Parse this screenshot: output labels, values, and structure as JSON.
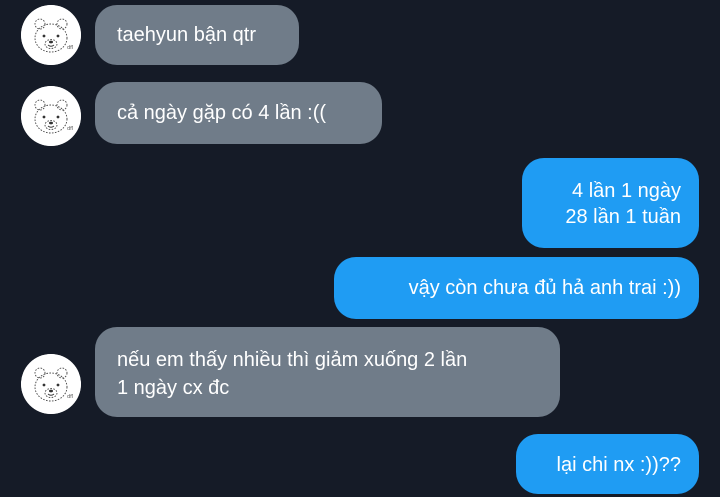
{
  "conversation": {
    "messages": [
      {
        "sender": "other",
        "lines": [
          "taehyun bận qtr"
        ]
      },
      {
        "sender": "other",
        "lines": [
          "cả ngày gặp có 4 lần :(("
        ]
      },
      {
        "sender": "me",
        "lines": [
          "4 lần 1 ngày",
          "28 lần 1 tuần"
        ]
      },
      {
        "sender": "me",
        "lines": [
          "vậy còn chưa đủ hả anh trai :))"
        ]
      },
      {
        "sender": "other",
        "lines": [
          "nếu em thấy nhiều thì giảm xuống 2 lần",
          "1 ngày cx đc"
        ]
      },
      {
        "sender": "me",
        "lines": [
          "lại chi nx :))??"
        ]
      }
    ]
  },
  "colors": {
    "background": "#151b27",
    "incoming_bubble": "#707c89",
    "outgoing_bubble": "#1f9cf3",
    "text": "#ffffff"
  },
  "icons": {
    "avatar": "bear-sketch-avatar-icon"
  }
}
